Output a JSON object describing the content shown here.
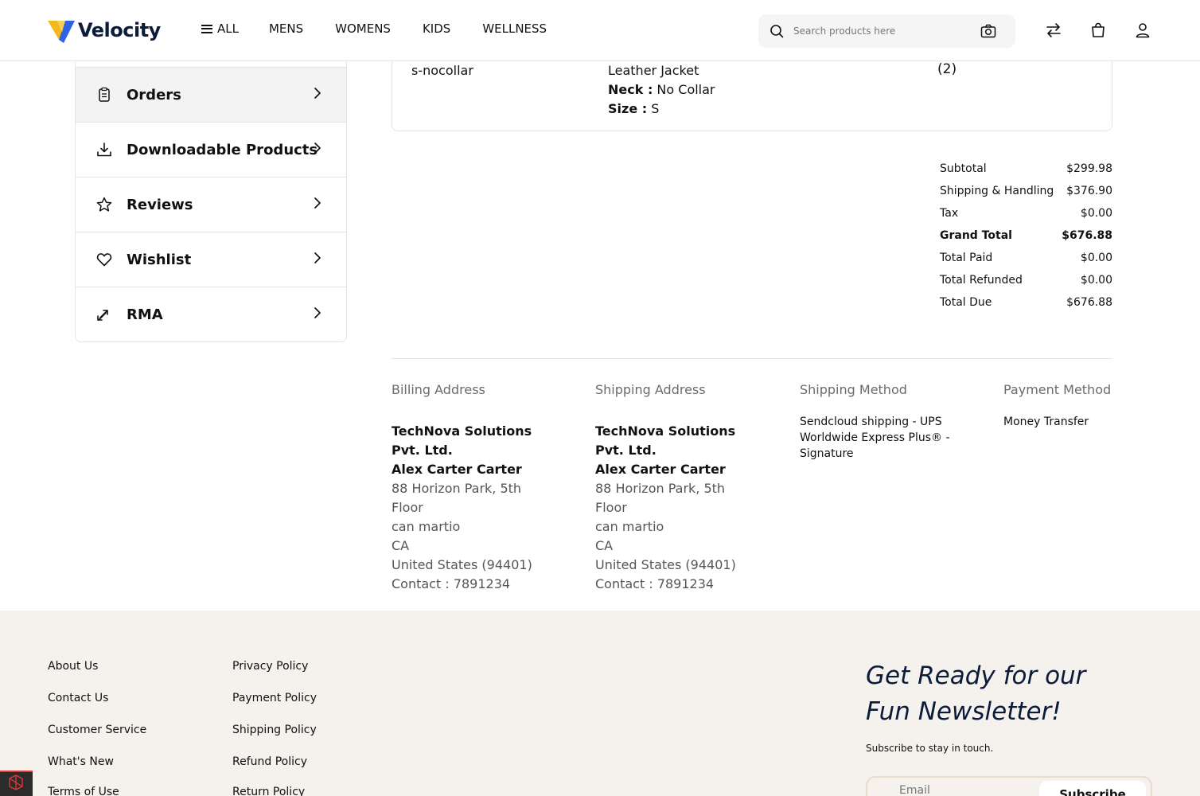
{
  "header": {
    "brand": "Velocity",
    "nav": [
      "ALL",
      "MENS",
      "WOMENS",
      "KIDS",
      "WELLNESS"
    ],
    "search_placeholder": "Search products here"
  },
  "sidebar": {
    "items": [
      {
        "label": "Orders",
        "icon": "clipboard-icon",
        "active": true
      },
      {
        "label": "Downloadable Products",
        "icon": "download-icon",
        "active": false
      },
      {
        "label": "Reviews",
        "icon": "star-icon",
        "active": false
      },
      {
        "label": "Wishlist",
        "icon": "heart-icon",
        "active": false
      },
      {
        "label": "RMA",
        "icon": "swap-icon",
        "active": false
      }
    ]
  },
  "order_item": {
    "sku": "s-nocollar",
    "name": "Leather Jacket",
    "attrs": [
      {
        "key": "Neck :",
        "value": " No Collar"
      },
      {
        "key": "Size :",
        "value": " S"
      }
    ],
    "qty": "(2)"
  },
  "summary": [
    {
      "label": "Subtotal",
      "value": "$299.98",
      "bold": false
    },
    {
      "label": "Shipping & Handling",
      "value": "$376.90",
      "bold": false
    },
    {
      "label": "Tax",
      "value": "$0.00",
      "bold": false
    },
    {
      "label": "Grand Total",
      "value": "$676.88",
      "bold": true
    },
    {
      "label": "Total Paid",
      "value": "$0.00",
      "bold": false
    },
    {
      "label": "Total Refunded",
      "value": "$0.00",
      "bold": false
    },
    {
      "label": "Total Due",
      "value": "$676.88",
      "bold": false
    }
  ],
  "billing": {
    "heading": "Billing Address",
    "company": "TechNova Solutions Pvt. Ltd.",
    "name": "Alex Carter Carter",
    "street": "88 Horizon Park, 5th Floor",
    "city": "can martio",
    "state": "CA",
    "country": "United States (94401)",
    "contact": "Contact : 7891234"
  },
  "shipping": {
    "heading": "Shipping Address",
    "company": "TechNova Solutions Pvt. Ltd.",
    "name": "Alex Carter Carter",
    "street": "88 Horizon Park, 5th Floor",
    "city": "can martio",
    "state": "CA",
    "country": "United States (94401)",
    "contact": "Contact : 7891234"
  },
  "shipping_method": {
    "heading": "Shipping Method",
    "value": "Sendcloud shipping - UPS Worldwide Express Plus® - Signature"
  },
  "payment_method": {
    "heading": "Payment Method",
    "value": "Money Transfer"
  },
  "footer": {
    "col1": [
      "About Us",
      "Contact Us",
      "Customer Service",
      "What's New",
      "Terms of Use"
    ],
    "col2": [
      "Privacy Policy",
      "Payment Policy",
      "Shipping Policy",
      "Refund Policy",
      "Return Policy"
    ],
    "newsletter_title": "Get Ready for our Fun Newsletter!",
    "newsletter_sub": "Subscribe to stay in touch.",
    "email_placeholder": "Email",
    "subscribe_label": "Subscribe"
  }
}
